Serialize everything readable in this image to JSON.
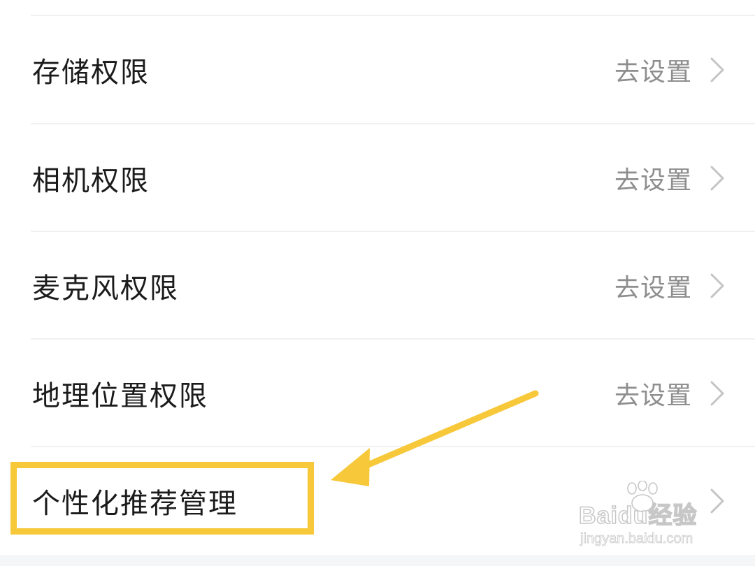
{
  "settings": {
    "items": [
      {
        "label": "存储权限",
        "action": "去设置"
      },
      {
        "label": "相机权限",
        "action": "去设置"
      },
      {
        "label": "麦克风权限",
        "action": "去设置"
      },
      {
        "label": "地理位置权限",
        "action": "去设置"
      },
      {
        "label": "个性化推荐管理",
        "action": ""
      }
    ]
  },
  "annotation": {
    "highlight_color": "#f7c83a",
    "arrow_color": "#f7c83a"
  },
  "watermark": {
    "brand": "Baidu经验",
    "url": "jingyan.baidu.com"
  }
}
